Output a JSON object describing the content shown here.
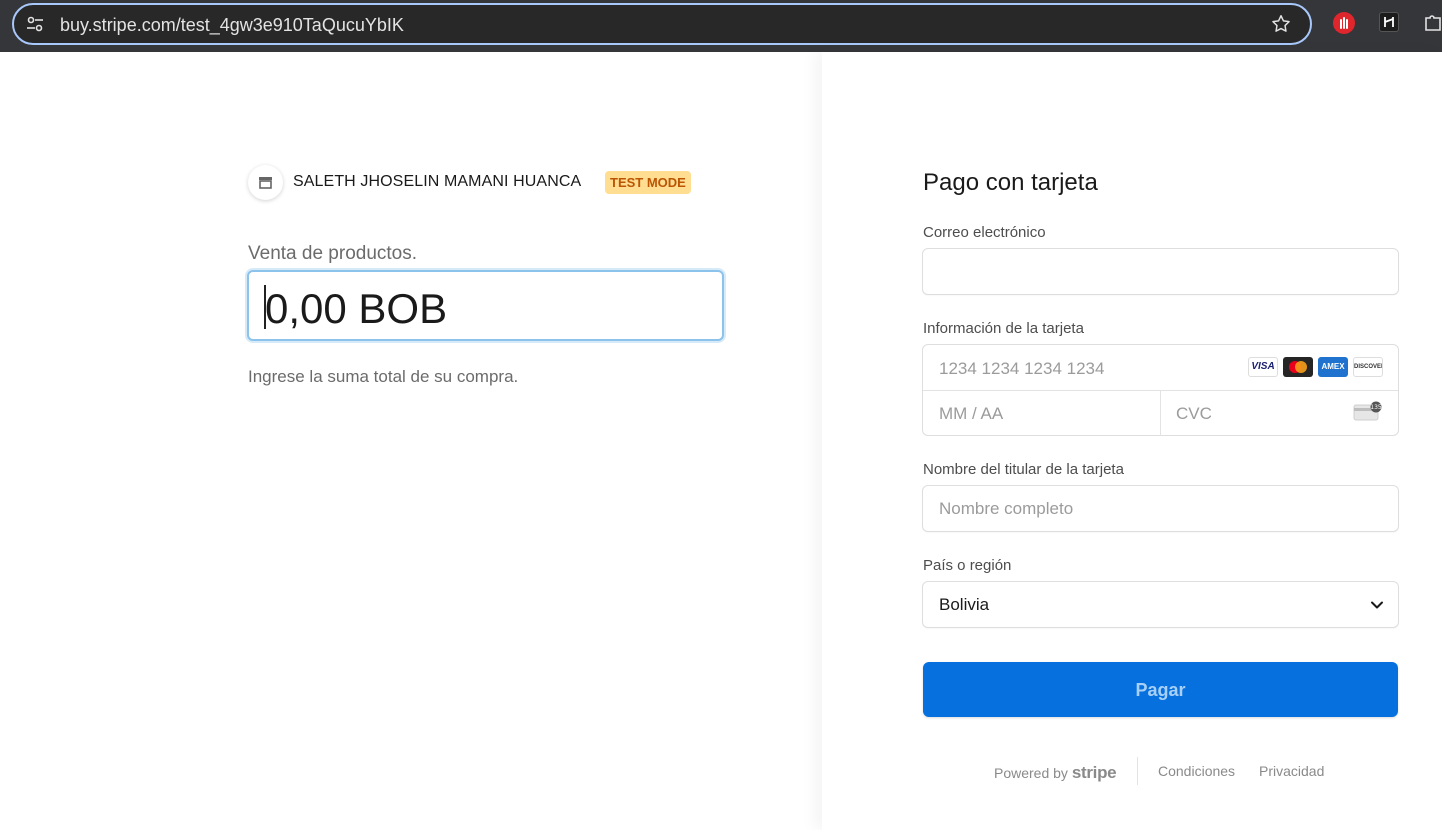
{
  "browser": {
    "url": "buy.stripe.com/test_4gw3e910TaQucuYbIK",
    "icons": [
      "tune-icon",
      "star-icon",
      "hand-extension-icon",
      "extension-icon",
      "puzzle-extensions-icon"
    ]
  },
  "merchant": {
    "name": "SALETH JHOSELIN MAMANI HUANCA",
    "badge": "TEST MODE",
    "icon": "store-icon"
  },
  "product": {
    "title": "Venta de productos.",
    "amount_value": "0,00 BOB",
    "hint": "Ingrese la suma total de su compra."
  },
  "payment": {
    "title": "Pago con tarjeta",
    "email": {
      "label": "Correo electrónico",
      "value": ""
    },
    "card": {
      "label": "Información de la tarjeta",
      "number_placeholder": "1234 1234 1234 1234",
      "expiry_placeholder": "MM / AA",
      "cvc_placeholder": "CVC",
      "brands": [
        "VISA",
        "mastercard",
        "AMEX",
        "DISCOVER"
      ],
      "cvc_icon_text": "135"
    },
    "holder": {
      "label": "Nombre del titular de la tarjeta",
      "placeholder": "Nombre completo"
    },
    "country": {
      "label": "País o región",
      "value": "Bolivia"
    },
    "submit_label": "Pagar"
  },
  "footer": {
    "powered_by": "Powered by",
    "stripe": "stripe",
    "terms": "Condiciones",
    "privacy": "Privacidad"
  },
  "colors": {
    "primary": "#0570de",
    "badge_bg": "#ffde92",
    "badge_text": "#bb5504",
    "focus_ring": "#8cc3ec"
  }
}
